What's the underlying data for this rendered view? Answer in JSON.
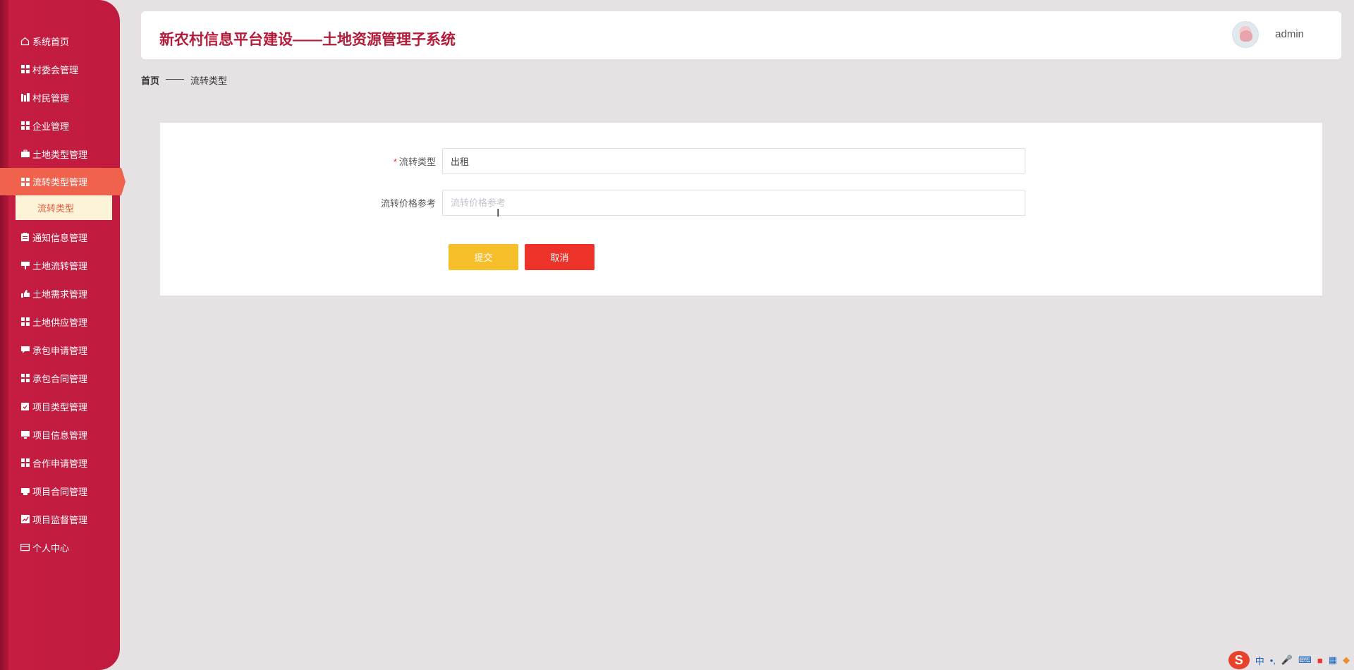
{
  "sidebar": {
    "items": [
      {
        "label": "系统首页",
        "icon": "home-icon"
      },
      {
        "label": "村委会管理",
        "icon": "grid-icon"
      },
      {
        "label": "村民管理",
        "icon": "building-icon"
      },
      {
        "label": "企业管理",
        "icon": "grid-icon"
      },
      {
        "label": "土地类型管理",
        "icon": "briefcase-icon"
      },
      {
        "label": "流转类型管理",
        "icon": "grid-icon",
        "active": true
      },
      {
        "label": "通知信息管理",
        "icon": "clipboard-icon"
      },
      {
        "label": "土地流转管理",
        "icon": "sign-icon"
      },
      {
        "label": "土地需求管理",
        "icon": "hand-icon"
      },
      {
        "label": "土地供应管理",
        "icon": "grid-icon"
      },
      {
        "label": "承包申请管理",
        "icon": "comment-icon"
      },
      {
        "label": "承包合同管理",
        "icon": "grid-icon"
      },
      {
        "label": "项目类型管理",
        "icon": "clipboard-check-icon"
      },
      {
        "label": "项目信息管理",
        "icon": "monitor-icon"
      },
      {
        "label": "合作申请管理",
        "icon": "grid-icon"
      },
      {
        "label": "项目合同管理",
        "icon": "printer-icon"
      },
      {
        "label": "项目监督管理",
        "icon": "chart-icon"
      },
      {
        "label": "个人中心",
        "icon": "card-icon"
      }
    ],
    "submenu_label": "流转类型"
  },
  "header": {
    "title": "新农村信息平台建设——土地资源管理子系统",
    "user": "admin"
  },
  "breadcrumb": {
    "home": "首页",
    "separator": "——",
    "current": "流转类型"
  },
  "form": {
    "type_label": "流转类型",
    "type_required": "*",
    "type_value": "出租",
    "price_label": "流转价格参考",
    "price_placeholder": "流转价格参考",
    "submit_label": "提交",
    "cancel_label": "取消"
  },
  "tray": {
    "ime_logo": "S",
    "ime_mode": "中"
  },
  "colors": {
    "sidebar": "#c01b3f",
    "active_item": "#f0624b",
    "title": "#b31b3a",
    "submit": "#f6be28",
    "cancel": "#ec3229"
  }
}
